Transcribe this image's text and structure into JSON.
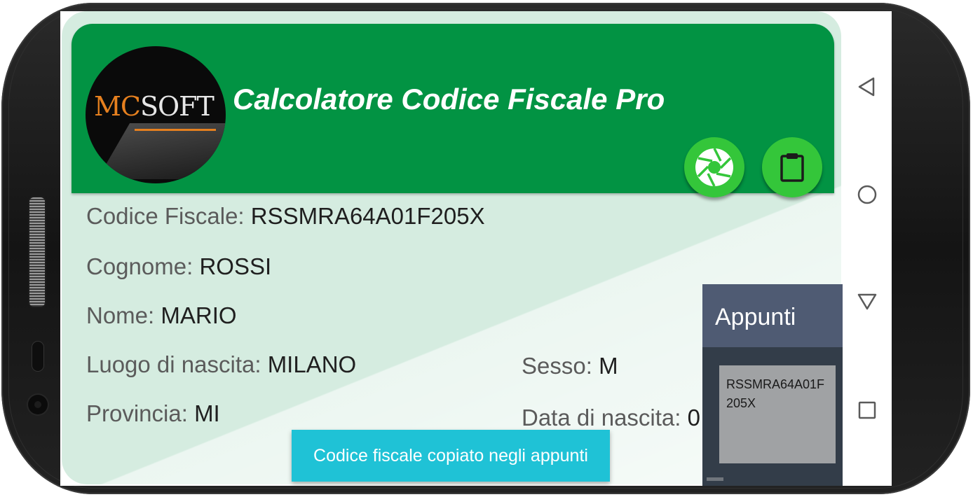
{
  "app": {
    "title": "Calcolatore Codice Fiscale Pro",
    "logo": {
      "text_mc": "MC",
      "text_soft": "SOFT"
    }
  },
  "actions": {
    "camera_icon": "camera-shutter-icon",
    "clipboard_icon": "clipboard-icon"
  },
  "fields": {
    "codice_fiscale": {
      "label": "Codice Fiscale:",
      "value": "RSSMRA64A01F205X"
    },
    "cognome": {
      "label": "Cognome:",
      "value": "ROSSI"
    },
    "nome": {
      "label": "Nome:",
      "value": "MARIO"
    },
    "luogo_nascita": {
      "label": "Luogo di nascita:",
      "value": "MILANO"
    },
    "sesso": {
      "label": "Sesso:",
      "value": "M"
    },
    "provincia": {
      "label": "Provincia:",
      "value": "MI"
    },
    "data_nascita": {
      "label": "Data di nascita:",
      "value": "0"
    }
  },
  "toast": {
    "text": "Codice fiscale copiato negli appunti"
  },
  "clipboard_panel": {
    "title": "Appunti",
    "items": [
      "RSSMRA64A01F205X"
    ]
  },
  "navbar": {
    "back_icon": "back-triangle-icon",
    "home_icon": "home-circle-icon",
    "notifications_icon": "down-triangle-icon",
    "recents_icon": "recents-square-icon"
  },
  "colors": {
    "header_green": "#029343",
    "fab_green": "#34c63a",
    "card_bg": "#d5ece0",
    "toast_bg": "#1fc2d6",
    "clip_head": "#4f5b73",
    "clip_body": "#333d49",
    "logo_orange": "#e6801f"
  }
}
